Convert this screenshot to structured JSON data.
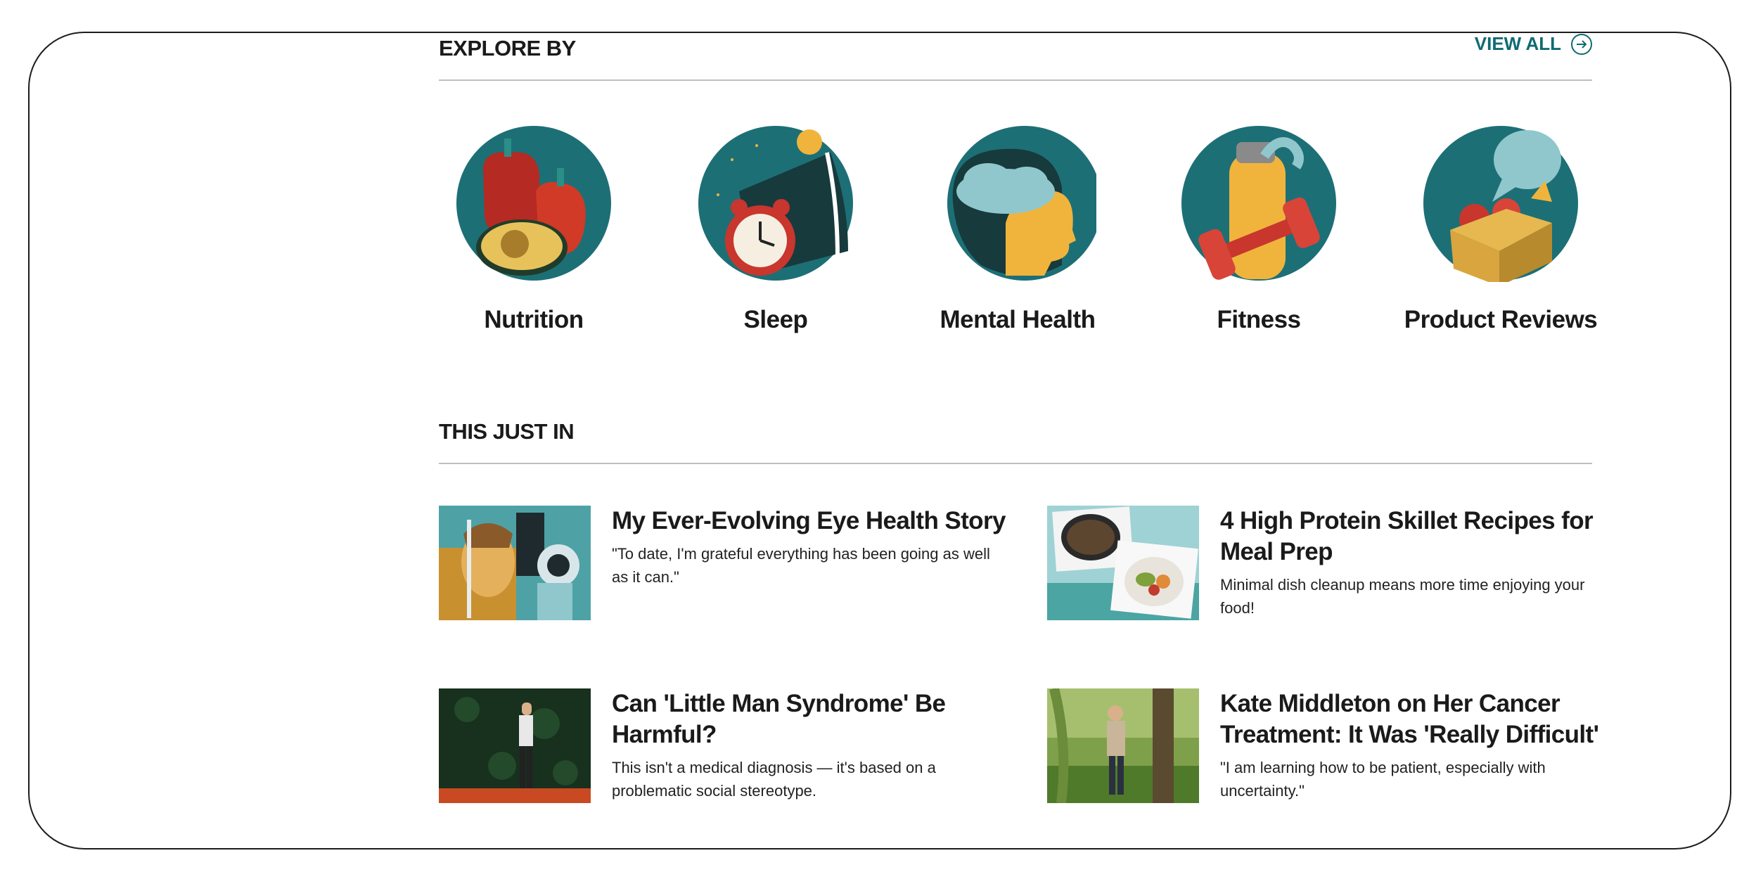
{
  "explore": {
    "title": "EXPLORE BY",
    "view_all": "VIEW ALL",
    "categories": [
      {
        "label": "Nutrition",
        "icon": "bell-peppers-avocado-icon"
      },
      {
        "label": "Sleep",
        "icon": "alarm-clock-pillow-icon"
      },
      {
        "label": "Mental Health",
        "icon": "head-cloud-icon"
      },
      {
        "label": "Fitness",
        "icon": "water-bottle-dumbbell-icon"
      },
      {
        "label": "Product Reviews",
        "icon": "box-speech-bubble-icon"
      }
    ]
  },
  "just_in": {
    "title": "THIS JUST IN",
    "articles": [
      {
        "headline": "My Ever-Evolving Eye Health Story",
        "dek": "\"To date, I'm grateful everything has been going as well as it can.\""
      },
      {
        "headline": "4 High Protein Skillet Recipes for Meal Prep",
        "dek": "Minimal dish cleanup means more time enjoying your food!"
      },
      {
        "headline": "Can 'Little Man Syndrome' Be Harmful?",
        "dek": "This isn't a medical diagnosis — it's based on a problematic social stereotype."
      },
      {
        "headline": "Kate Middleton on Her Cancer Treatment: It Was 'Really Difficult'",
        "dek": "\"I am learning how to be patient, especially with uncertainty.\""
      }
    ]
  },
  "colors": {
    "accent": "#0f6b72",
    "icon_circle": "#1d6f76",
    "divider": "#bfbfbf"
  }
}
